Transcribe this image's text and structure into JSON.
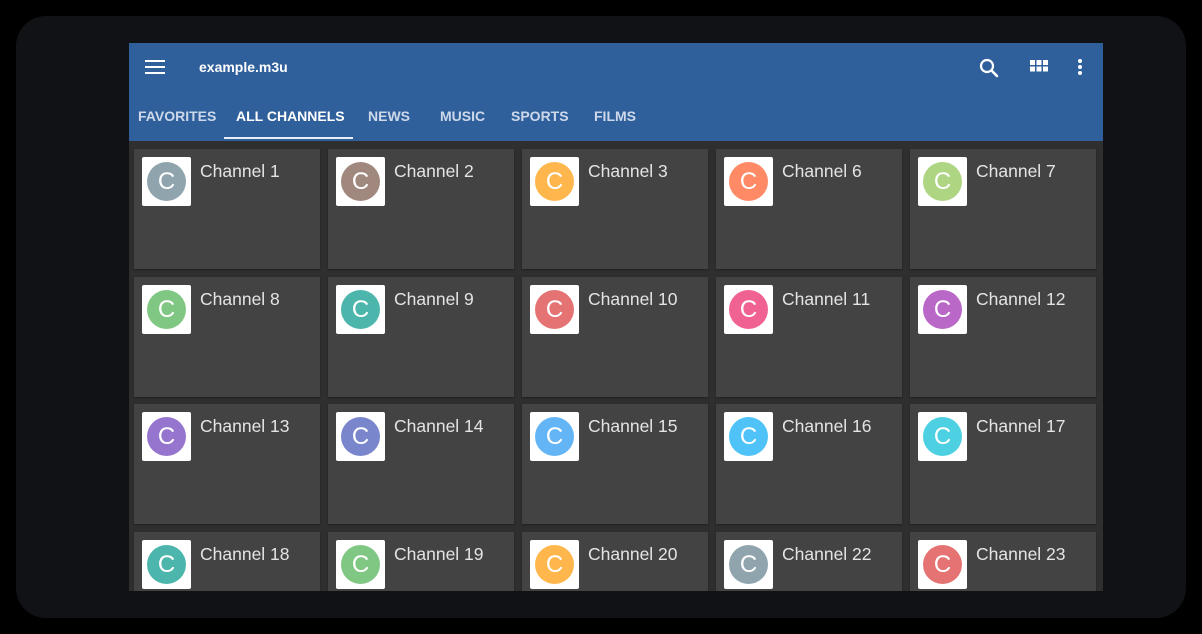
{
  "appbar": {
    "title": "example.m3u",
    "actions": [
      "search-icon",
      "grid-view-icon",
      "more-vert-icon"
    ],
    "color": "#30609b"
  },
  "tabs": [
    {
      "label": "FAVORITES",
      "active": false
    },
    {
      "label": "ALL CHANNELS",
      "active": true
    },
    {
      "label": "NEWS",
      "active": false
    },
    {
      "label": "MUSIC",
      "active": false
    },
    {
      "label": "SPORTS",
      "active": false
    },
    {
      "label": "FILMS",
      "active": false
    }
  ],
  "channels": [
    {
      "name": "Channel 1",
      "letter": "C",
      "color": "#90a4ae"
    },
    {
      "name": "Channel 2",
      "letter": "C",
      "color": "#a1887f"
    },
    {
      "name": "Channel 3",
      "letter": "C",
      "color": "#ffb74d"
    },
    {
      "name": "Channel 6",
      "letter": "C",
      "color": "#ff8a65"
    },
    {
      "name": "Channel 7",
      "letter": "C",
      "color": "#aed581"
    },
    {
      "name": "Channel 8",
      "letter": "C",
      "color": "#81c784"
    },
    {
      "name": "Channel 9",
      "letter": "C",
      "color": "#4db6ac"
    },
    {
      "name": "Channel 10",
      "letter": "C",
      "color": "#e57373"
    },
    {
      "name": "Channel 11",
      "letter": "C",
      "color": "#f06292"
    },
    {
      "name": "Channel 12",
      "letter": "C",
      "color": "#ba68c8"
    },
    {
      "name": "Channel 13",
      "letter": "C",
      "color": "#9575cd"
    },
    {
      "name": "Channel 14",
      "letter": "C",
      "color": "#7986cb"
    },
    {
      "name": "Channel 15",
      "letter": "C",
      "color": "#64b5f6"
    },
    {
      "name": "Channel 16",
      "letter": "C",
      "color": "#4fc3f7"
    },
    {
      "name": "Channel 17",
      "letter": "C",
      "color": "#4dd0e1"
    },
    {
      "name": "Channel 18",
      "letter": "C",
      "color": "#4db6ac"
    },
    {
      "name": "Channel 19",
      "letter": "C",
      "color": "#81c784"
    },
    {
      "name": "Channel 20",
      "letter": "C",
      "color": "#ffb74d"
    },
    {
      "name": "Channel 22",
      "letter": "C",
      "color": "#90a4ae"
    },
    {
      "name": "Channel 23",
      "letter": "C",
      "color": "#e57373"
    }
  ]
}
